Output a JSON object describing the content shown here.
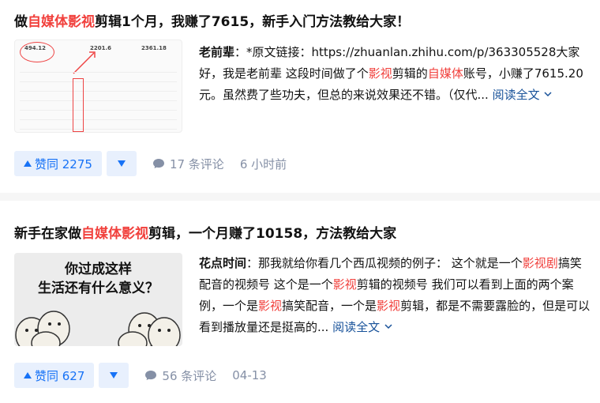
{
  "items": [
    {
      "title_parts": [
        "做",
        "自媒体影视",
        "剪辑1个月，我赚了7615，新手入门方法教给大家！"
      ],
      "author": "老前辈",
      "excerpt_parts": [
        "：*原文链接：https://zhuanlan.zhihu.com/p/363305528大家好，我是老前辈 这段时间做了个",
        "影视",
        "剪辑的",
        "自媒体",
        "账号，小赚了7615.20元。虽然费了些功夫，但总的来说效果还不错。（仅代..."
      ],
      "read_more": "阅读全文",
      "vote_label": "赞同 2275",
      "comment_label": "17 条评论",
      "time": "6 小时前",
      "thumb_stats": [
        "494.12",
        "2201.6",
        "2361.18"
      ]
    },
    {
      "title_parts": [
        "新手在家做",
        "自媒体影视",
        "剪辑，一个月赚了10158，方法教给大家"
      ],
      "author": "花点时间",
      "excerpt_parts": [
        "：那我就给你看几个西瓜视频的例子： 这个就是一个",
        "影视剧",
        "搞笑配音的视频号 这个是一个",
        "影视",
        "剪辑的视频号 我们可以看到上面的两个案例，一个是",
        "影视",
        "搞笑配音，一个是",
        "影视",
        "剪辑，都是不需要露脸的，但是可以看到播放量还是挺高的..."
      ],
      "read_more": "阅读全文",
      "vote_label": "赞同 627",
      "comment_label": "56 条评论",
      "time": "04-13",
      "meme_lines": [
        "你过成这样",
        "生活还有什么意义？"
      ]
    }
  ],
  "colors": {
    "highlight": "#f1403c",
    "link": "#175199",
    "vote_bg": "#e8f0fd",
    "vote_fg": "#1772f6",
    "meta": "#8590a6"
  },
  "icons": [
    "vote-up-triangle-icon",
    "vote-down-triangle-icon",
    "comment-bubble-icon",
    "chevron-down-icon"
  ]
}
